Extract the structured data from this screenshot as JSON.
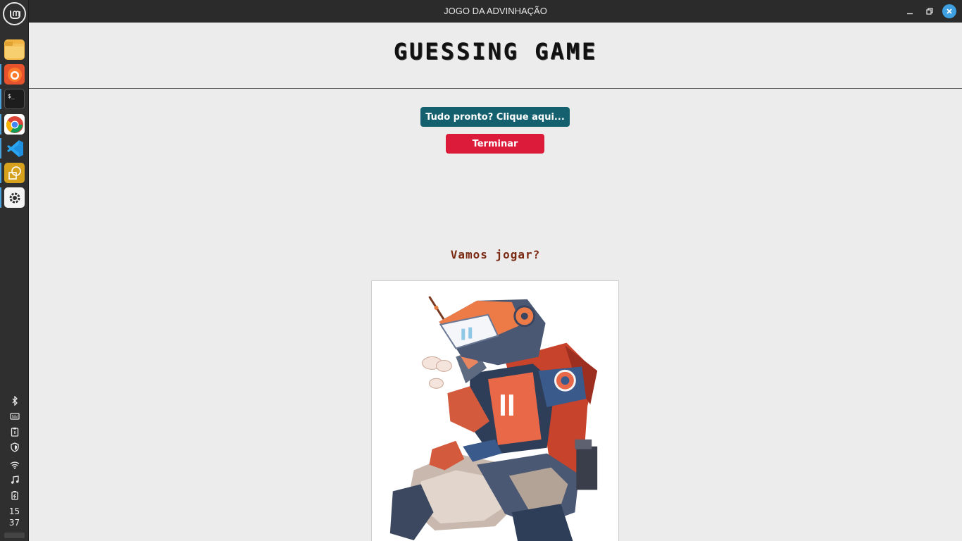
{
  "window": {
    "title": "JOGO DA ADVINHAÇÃO"
  },
  "app": {
    "heading": "GUESSING GAME",
    "start_button": "Tudo pronto? Clique aqui...",
    "end_button": "Terminar",
    "prompt": "Vamos jogar?",
    "image_icon": "robot-illustration"
  },
  "dock": {
    "apps": [
      "files-icon",
      "firefox-icon",
      "terminal-icon",
      "chrome-icon",
      "vscode-icon",
      "drawing-icon",
      "settings-icon"
    ],
    "tray": [
      "bluetooth-icon",
      "keyboard-icon",
      "clipboard-icon",
      "shield-icon",
      "wifi-icon",
      "music-icon",
      "battery-icon"
    ],
    "clock_hour": "15",
    "clock_minute": "37"
  },
  "colors": {
    "start_button": "#14606e",
    "end_button": "#dc1a3a",
    "prompt_text": "#7a2a12",
    "background": "#ececec"
  }
}
